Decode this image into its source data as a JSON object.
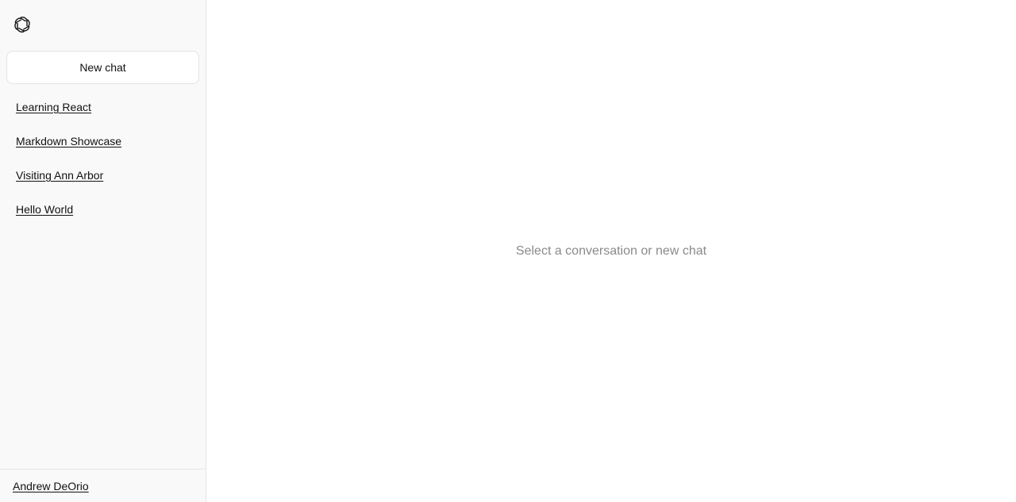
{
  "sidebar": {
    "logo_icon": "openai-logo-icon",
    "new_chat_label": "New chat",
    "conversations": [
      {
        "label": "Learning React"
      },
      {
        "label": "Markdown Showcase"
      },
      {
        "label": "Visiting Ann Arbor"
      },
      {
        "label": "Hello World"
      }
    ],
    "user_name": "Andrew DeOrio"
  },
  "main": {
    "empty_message": "Select a conversation or new chat"
  },
  "colors": {
    "sidebar_bg": "#f9f9f9",
    "muted_text": "#8a8a8a",
    "border": "#e5e5e5"
  }
}
